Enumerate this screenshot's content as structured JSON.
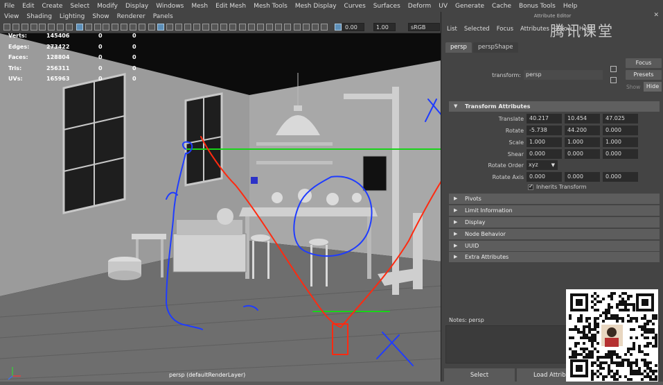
{
  "main_menu": [
    "File",
    "Edit",
    "Create",
    "Select",
    "Modify",
    "Display",
    "Windows",
    "Mesh",
    "Edit Mesh",
    "Mesh Tools",
    "Mesh Display",
    "Curves",
    "Surfaces",
    "Deform",
    "UV",
    "Generate",
    "Cache",
    "Bonus Tools",
    "Help"
  ],
  "panel_menu": [
    "View",
    "Shading",
    "Lighting",
    "Show",
    "Renderer",
    "Panels"
  ],
  "panel_toolbar": {
    "field1": "0.00",
    "field2": "1.00",
    "colorspace": "sRGB gamm"
  },
  "hud": {
    "rows": [
      {
        "label": "Verts:",
        "v1": "145406",
        "v2": "0",
        "v3": "0"
      },
      {
        "label": "Edges:",
        "v1": "273422",
        "v2": "0",
        "v3": "0"
      },
      {
        "label": "Faces:",
        "v1": "128804",
        "v2": "0",
        "v3": "0"
      },
      {
        "label": "Tris:",
        "v1": "256311",
        "v2": "0",
        "v3": "0"
      },
      {
        "label": "UVs:",
        "v1": "165963",
        "v2": "0",
        "v3": "0"
      }
    ]
  },
  "viewport": {
    "camera_label": "persp (defaultRenderLayer)",
    "wall_color": "#9b9b9b",
    "annotation_colors": {
      "blue": "#1f3cff",
      "red": "#ff2a10",
      "green": "#18d418"
    }
  },
  "attribute_editor": {
    "title": "Attribute Editor",
    "menu": [
      "List",
      "Selected",
      "Focus",
      "Attributes",
      "Show",
      "Help"
    ],
    "watermark": "腾讯课堂",
    "tabs": [
      "persp",
      "perspShape"
    ],
    "transform_label": "transform:",
    "transform_value": "persp",
    "focus_button": "Focus",
    "presets_button": "Presets",
    "show_label": "Show",
    "hide_button": "Hide",
    "transform_section": "Transform Attributes",
    "attrs": {
      "translate": {
        "label": "Translate",
        "x": "40.217",
        "y": "10.454",
        "z": "47.025"
      },
      "rotate": {
        "label": "Rotate",
        "x": "-5.738",
        "y": "44.200",
        "z": "0.000"
      },
      "scale": {
        "label": "Scale",
        "x": "1.000",
        "y": "1.000",
        "z": "1.000"
      },
      "shear": {
        "label": "Shear",
        "x": "0.000",
        "y": "0.000",
        "z": "0.000"
      },
      "rotate_order": {
        "label": "Rotate Order",
        "value": "xyz"
      },
      "rotate_axis": {
        "label": "Rotate Axis",
        "x": "0.000",
        "y": "0.000",
        "z": "0.000"
      },
      "inherits": {
        "label": "Inherits Transform",
        "checked": true
      }
    },
    "sections": [
      "Pivots",
      "Limit Information",
      "Display",
      "Node Behavior",
      "UUID",
      "Extra Attributes"
    ],
    "notes_label": "Notes:  persp",
    "select_button": "Select",
    "load_button": "Load Attribu"
  }
}
